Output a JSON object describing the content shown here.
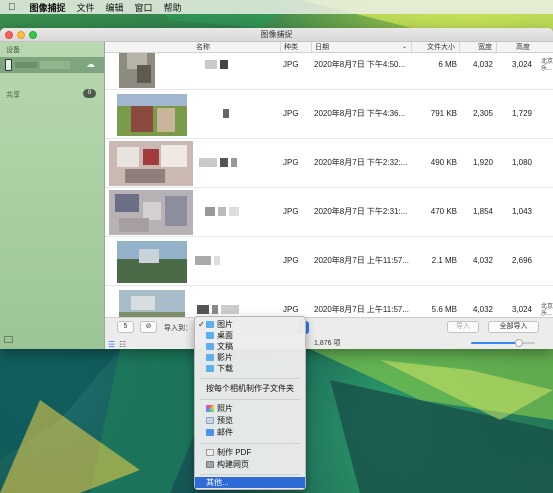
{
  "menubar": {
    "app_name": "图像捕捉",
    "items": [
      "文件",
      "编辑",
      "窗口",
      "帮助"
    ]
  },
  "window": {
    "title": "图像捕捉"
  },
  "sidebar": {
    "devices_heading": "设备",
    "shared_heading": "共享",
    "shared_count": "0"
  },
  "table": {
    "headers": {
      "name": "名称",
      "kind": "种类",
      "date": "日期",
      "size": "文件大小",
      "width": "宽度",
      "height": "高度"
    },
    "rows": [
      {
        "kind": "JPG",
        "date": "2020年8月7日 下午4:50...",
        "size": "6 MB",
        "width": "4,032",
        "height": "3,024",
        "edge": "北京 乐..."
      },
      {
        "kind": "JPG",
        "date": "2020年8月7日 下午4:36...",
        "size": "791 KB",
        "width": "2,305",
        "height": "1,729",
        "edge": ""
      },
      {
        "kind": "JPG",
        "date": "2020年8月7日 下午2:32:...",
        "size": "490 KB",
        "width": "1,920",
        "height": "1,080",
        "edge": ""
      },
      {
        "kind": "JPG",
        "date": "2020年8月7日 下午2:31:...",
        "size": "470 KB",
        "width": "1,854",
        "height": "1,043",
        "edge": ""
      },
      {
        "kind": "JPG",
        "date": "2020年8月7日 上午11:57...",
        "size": "2.1 MB",
        "width": "4,032",
        "height": "2,696",
        "edge": ""
      },
      {
        "kind": "JPG",
        "date": "2020年8月7日 上午11:57...",
        "size": "5.6 MB",
        "width": "4,032",
        "height": "3,024",
        "edge": "北京 乐..."
      }
    ]
  },
  "toolbar": {
    "rotate_label": "5",
    "import_to_label": "导入到：",
    "import_button": "导入",
    "import_all_button": "全部导入",
    "item_count": "1,876 项",
    "thumbnail_size": 0.75
  },
  "dropdown": {
    "folders": [
      "图片",
      "桌面",
      "文稿",
      "影片",
      "下载"
    ],
    "make_subfolders": "按每个相机制作子文件夹",
    "apps": [
      "照片",
      "预览",
      "邮件"
    ],
    "actions": [
      "制作 PDF",
      "构建网页"
    ],
    "other": "其他..."
  }
}
